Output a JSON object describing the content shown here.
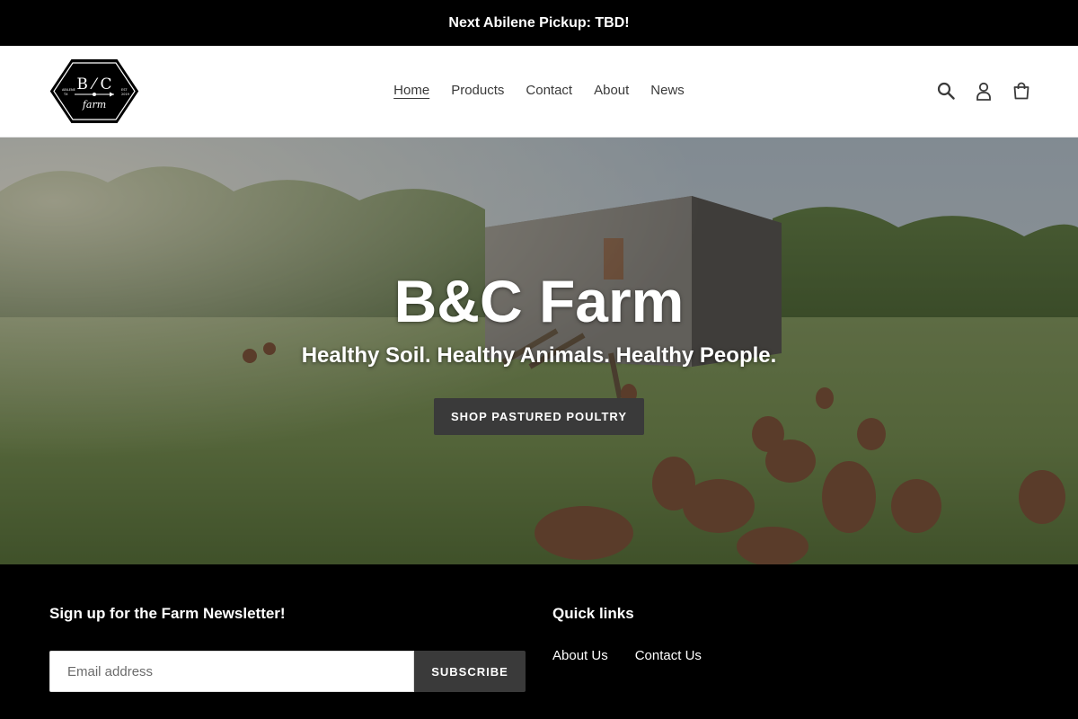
{
  "announcement": {
    "text": "Next Abilene Pickup: TBD!"
  },
  "header": {
    "logo": {
      "brand": "B&C",
      "word": "farm",
      "left_small": "ABILENE TX",
      "right_small": "EST 2019"
    },
    "nav": [
      {
        "label": "Home",
        "active": true
      },
      {
        "label": "Products",
        "active": false
      },
      {
        "label": "Contact",
        "active": false
      },
      {
        "label": "About",
        "active": false
      },
      {
        "label": "News",
        "active": false
      }
    ],
    "icons": [
      "search-icon",
      "account-icon",
      "cart-icon"
    ]
  },
  "hero": {
    "title": "B&C Farm",
    "subtitle": "Healthy Soil. Healthy Animals. Healthy People.",
    "button_label": "SHOP PASTURED POULTRY"
  },
  "footer": {
    "newsletter_title": "Sign up for the Farm Newsletter!",
    "email_placeholder": "Email address",
    "subscribe_label": "SUBSCRIBE",
    "quick_links_title": "Quick links",
    "quick_links": [
      "About Us",
      "Contact Us"
    ]
  },
  "colors": {
    "announcement_bg": "#000000",
    "button_bg": "#3a3a3a",
    "footer_bg": "#000000"
  }
}
